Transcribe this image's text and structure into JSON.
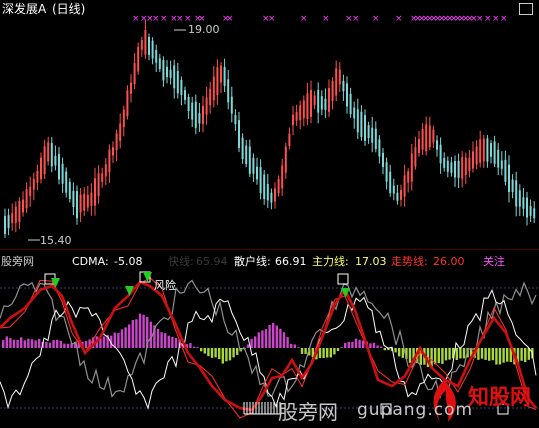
{
  "stock_title": "深发展A",
  "period_label": "(日线)",
  "upper": {
    "high_label": "19.00",
    "low_label": "15.40",
    "panel_button_glyph": "▫"
  },
  "lower": {
    "name": "股旁网",
    "indicator": {
      "label": "CDMA:",
      "value": "-5.08"
    },
    "fast_line": {
      "label": "快线:",
      "value": "65.94"
    },
    "retail_line": {
      "label": "散户线:",
      "value": "66.91"
    },
    "main_line": {
      "label": "主力线:",
      "value": "17.03"
    },
    "trend_line": {
      "label": "走势线:",
      "value": "26.00"
    },
    "follow_label": "关注",
    "risk_label": "风险"
  },
  "watermark": {
    "logo_text": "知股网",
    "cn_text": "股旁网",
    "url_text": "gupang.com"
  },
  "colors": {
    "background": "#000000",
    "candle_up": "#ff5050",
    "candle_down": "#7fd8d8",
    "signal_magenta": "#ff40ff",
    "white_line": "#ffffff",
    "red_line": "#cc1010",
    "gray_line": "#909090",
    "hist_up": "#cc44cc",
    "hist_down": "#a8d83c",
    "arrow_green": "#22cc22",
    "label_yellow": "#ffff66",
    "label_red": "#ff3030",
    "label_magenta": "#ff50ff"
  }
}
